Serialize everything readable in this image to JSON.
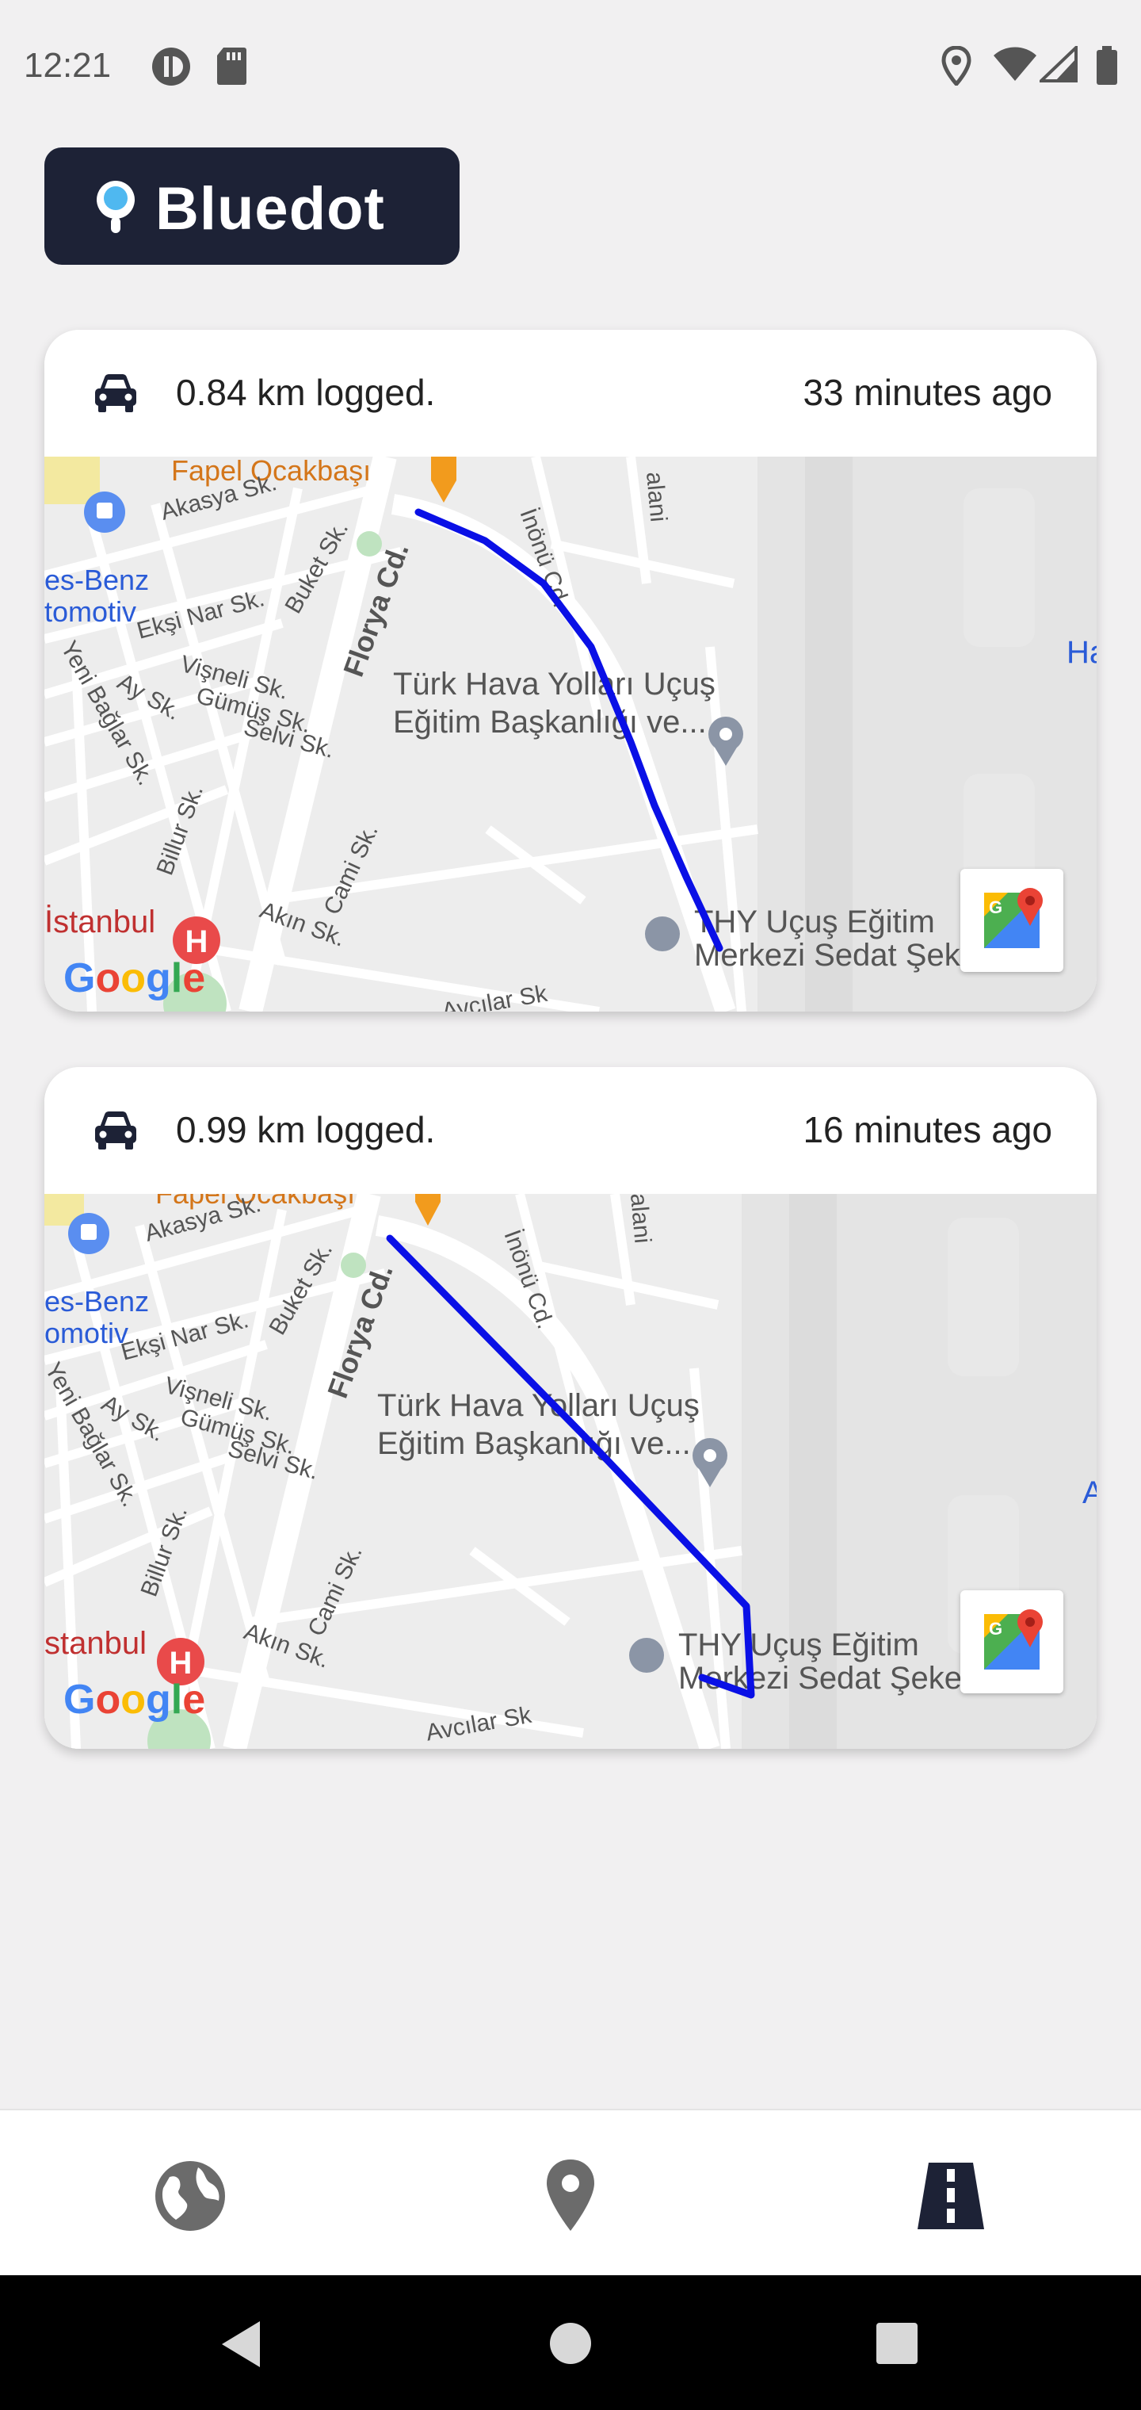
{
  "status_bar": {
    "time": "12:21",
    "left_icons": [
      "data-saver-icon",
      "sd-card-icon"
    ],
    "right_icons": [
      "location-icon",
      "wifi-icon",
      "signal-icon",
      "battery-icon"
    ]
  },
  "brand": {
    "name": "Bluedot",
    "bg_color": "#1d2236",
    "dot_color": "#4fb8f0"
  },
  "trips": [
    {
      "distance_text": "0.84 km logged.",
      "time_ago": "33 minutes ago",
      "map": {
        "labels": {
          "fapel": "Fapel Ocakbaşı",
          "akasya": "Akasya Sk.",
          "benz": "es-Benz",
          "otomotiv": "tomotiv",
          "eksi": "Ekşi Nar Sk.",
          "buket": "Buket Sk.",
          "florya": "Florya Cd.",
          "visneli": "Vişneli Sk.",
          "gumus": "Gümüş Sk.",
          "selvi": "Selvi Sk.",
          "ay": "Ay Sk.",
          "yeni": "Yeni Bağlar Sk.",
          "inonu": "İnönü Cd.",
          "alani": "alani",
          "thy1": "Türk Hava Yolları Uçuş",
          "thy2": "Eğitim Başkanlığı ve...",
          "billur": "Billur Sk.",
          "cami": "Cami Sk.",
          "akin": "Akın Sk.",
          "avcilar": "Avcılar Sk",
          "istanbul": "İstanbul",
          "merkez1": "THY Uçuş Eğitim",
          "merkez2": "Merkezi Sedat Şekerci...",
          "ha": "Ha",
          "google": "Google"
        }
      }
    },
    {
      "distance_text": "0.99 km logged.",
      "time_ago": "16 minutes ago",
      "map": {
        "labels": {
          "fapel": "Fapel Ocakbaşı",
          "akasya": "Akasya Sk.",
          "benz": "es-Benz",
          "otomotiv": "omotiv",
          "eksi": "Ekşi Nar Sk.",
          "buket": "Buket Sk.",
          "florya": "Florya Cd.",
          "visneli": "Vişneli Sk.",
          "gumus": "Gümüş Sk.",
          "selvi": "Selvi Sk.",
          "ay": "Ay Sk.",
          "yeni": "Yeni Bağlar Sk.",
          "inonu": "İnönü Cd.",
          "alani": "alani",
          "thy1": "Türk Hava Yolları Uçuş",
          "thy2": "Eğitim Başkanlığı ve...",
          "billur": "Billur Sk.",
          "cami": "Cami Sk.",
          "akin": "Akın Sk.",
          "avcilar": "Avcılar Sk",
          "istanbul": "stanbul",
          "merkez1": "THY Uçuş Eğitim",
          "merkez2": "Merkezi Sedat Şekerci...",
          "ha": "A\nHa",
          "google": "Google"
        }
      }
    }
  ],
  "route_color": "#0a10e6",
  "bottom_nav": {
    "items": [
      {
        "icon": "globe-icon",
        "active": false
      },
      {
        "icon": "location-pin-icon",
        "active": false
      },
      {
        "icon": "road-icon",
        "active": true
      }
    ],
    "active_color": "#1d2236",
    "inactive_color": "#6b6b6b"
  },
  "system_nav": {
    "icons": [
      "back-icon",
      "home-icon",
      "recents-icon"
    ]
  }
}
